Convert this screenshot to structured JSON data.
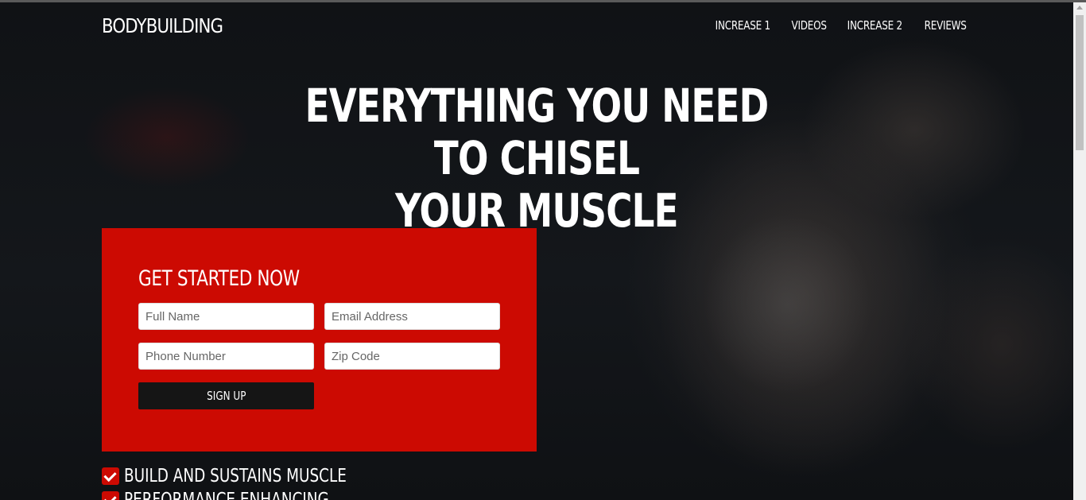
{
  "brand": "BODYBUILDING",
  "nav": [
    {
      "label": "INCREASE 1"
    },
    {
      "label": "VIDEOS"
    },
    {
      "label": "INCREASE 2"
    },
    {
      "label": "REVIEWS"
    }
  ],
  "hero": {
    "line1": "EVERYTHING YOU NEED TO CHISEL",
    "line2": "YOUR MUSCLE"
  },
  "form": {
    "title": "GET STARTED NOW",
    "full_name_placeholder": "Full Name",
    "email_placeholder": "Email Address",
    "phone_placeholder": "Phone Number",
    "zip_placeholder": "Zip Code",
    "submit_label": "SIGN UP"
  },
  "features": [
    {
      "label": "BUILD AND SUSTAINS MUSCLE"
    },
    {
      "label": "PERFORMANCE ENHANCING"
    }
  ],
  "colors": {
    "accent": "#cc0a02",
    "button": "#151515",
    "background": "#0d0f12"
  }
}
